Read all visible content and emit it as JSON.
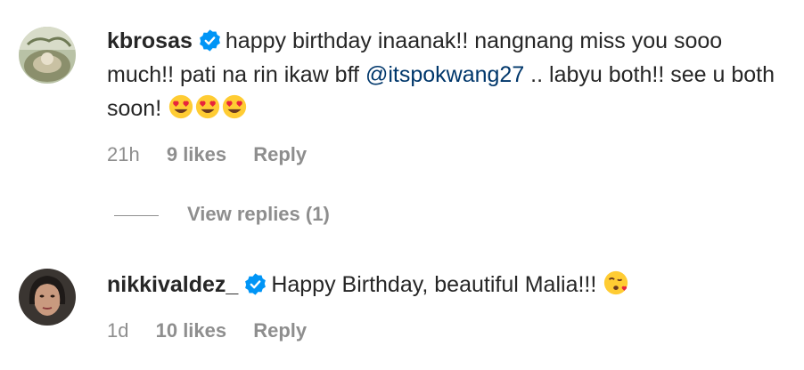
{
  "comments": [
    {
      "username": "kbrosas",
      "text_before": "happy birthday inaanak!! nangnang miss you sooo much!! pati na rin ikaw bff ",
      "mention": "@itspokwang27",
      "text_after": " .. labyu both!! see u both soon! ",
      "emoji": [
        "heart-eyes",
        "heart-eyes",
        "heart-eyes"
      ],
      "time": "21h",
      "likes": "9 likes",
      "reply": "Reply",
      "view_replies": "View replies (1)"
    },
    {
      "username": "nikkivaldez_",
      "text_before": "Happy Birthday, beautiful Malia!!! ",
      "emoji": [
        "kissing-heart"
      ],
      "time": "1d",
      "likes": "10 likes",
      "reply": "Reply"
    }
  ],
  "colors": {
    "text": "#262626",
    "meta": "#8e8e8e",
    "mention": "#00376b",
    "verified": "#0095f6"
  }
}
